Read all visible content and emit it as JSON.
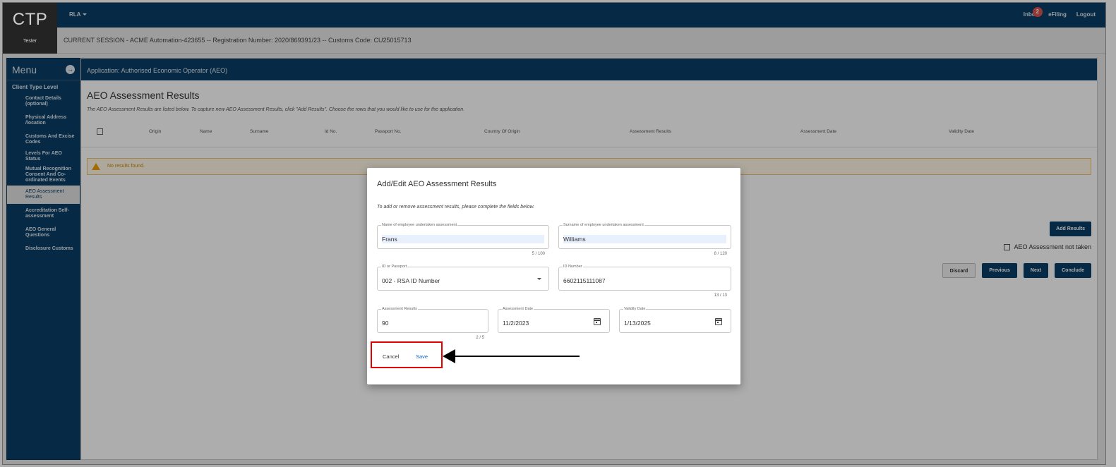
{
  "header": {
    "logo": "CTP",
    "user_role": "Tester",
    "rla": "RLA",
    "links": [
      "Inbox",
      "eFiling",
      "Logout"
    ],
    "inbox_count": "2",
    "session": "CURRENT SESSION - ACME Automation-423655 -- Registration Number: 2020/869391/23 -- Customs Code: CU25015713"
  },
  "sidebar": {
    "title": "Menu",
    "level": "Client Type Level",
    "items": [
      "Contact Details (optional)",
      "Physical Address /location",
      "Customs And Excise Codes",
      "Levels For AEO Status",
      "Mutual Recognition Consent And Co-ordinated Events",
      "AEO Assessment Results",
      "Accreditation Self-assessment",
      "AEO General Questions",
      "Disclosure Customs"
    ],
    "active_index": 5
  },
  "main": {
    "app_title": "Application: Authorised Economic Operator (AEO)",
    "page_title": "AEO Assessment Results",
    "description": "The AEO Assessment Results are listed below. To capture new AEO Assessment Results, click \"Add Results\". Choose the rows that you would like to use for the application.",
    "columns": [
      "Origin",
      "Name",
      "Surname",
      "Id No.",
      "Passport No.",
      "Country Of Origin",
      "Assessment Results",
      "Assessment Date",
      "Validity Date"
    ],
    "no_results": "No results found.",
    "add_results": "Add Results",
    "not_taken_label": "AEO Assessment not taken",
    "buttons": {
      "discard": "Discard",
      "previous": "Previous",
      "next": "Next",
      "conclude": "Conclude"
    }
  },
  "modal": {
    "title": "Add/Edit AEO Assessment Results",
    "description": "To add or remove assessment results, please complete the fields below.",
    "name_label": "Name of employee undertaken assessment",
    "name_value": "Frans",
    "name_counter": "5 / 100",
    "surname_label": "Surname of employee undertaken assessment",
    "surname_value": "Williams",
    "surname_counter": "8 / 120",
    "id_type_label": "ID or Passport",
    "id_type_value": "002 - RSA ID Number",
    "id_number_label": "ID Number",
    "id_number_value": "6602115111087",
    "id_number_counter": "13 / 13",
    "results_label": "Assessment Results",
    "results_value": "90",
    "results_counter": "2 / 5",
    "assess_date_label": "Assessment Date",
    "assess_date_value": "11/2/2023",
    "validity_label": "Validity Date",
    "validity_value": "1/13/2025",
    "cancel": "Cancel",
    "save": "Save"
  }
}
